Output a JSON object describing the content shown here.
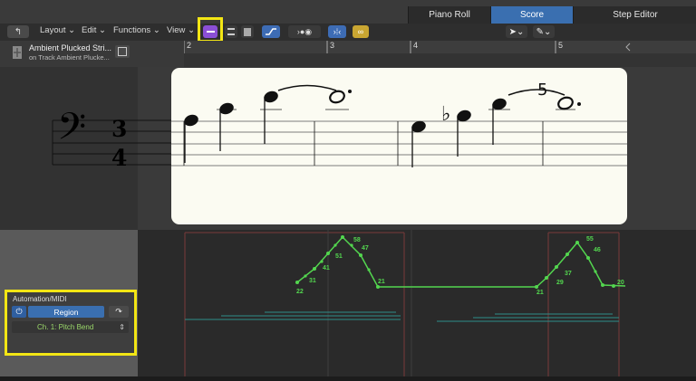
{
  "tabs": [
    {
      "label": "Piano Roll",
      "active": false
    },
    {
      "label": "Score",
      "active": true
    },
    {
      "label": "Step Editor",
      "active": false
    }
  ],
  "toolbar": {
    "layout_label": "Layout",
    "edit_label": "Edit",
    "functions_label": "Functions",
    "view_label": "View",
    "accent_highlight": "#f3e614",
    "icons": [
      "catch-icon",
      "linear-view-icon",
      "page-view-icon",
      "print-view-icon",
      "automation-curve-icon",
      "midi-in-icon",
      "link-icon",
      "pointer-tool-icon",
      "pencil-tool-icon"
    ]
  },
  "region_header": {
    "title": "Ambient Plucked Stri...",
    "subtitle": "on Track Ambient Plucke..."
  },
  "ruler": {
    "bars": [
      "2",
      "3",
      "4",
      "5"
    ]
  },
  "score": {
    "clef": "bass",
    "time_signature_top": "3",
    "time_signature_bottom": "4",
    "tuplet_number": "5"
  },
  "automation_panel": {
    "title": "Automation/MIDI",
    "region_button_label": "Region",
    "parameter_label": "Ch. 1: Pitch Bend"
  },
  "automation_points": [
    "22",
    "31",
    "41",
    "51",
    "58",
    "47",
    "21",
    "21",
    "29",
    "37",
    "55",
    "46",
    "20"
  ],
  "colors": {
    "automation_line": "#53d64f",
    "active_tab": "#3a6fb0",
    "highlight_box": "#f3e614"
  }
}
